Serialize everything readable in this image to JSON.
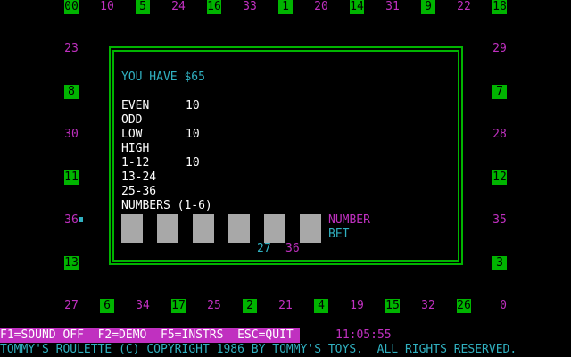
{
  "colors": {
    "background": "#000000",
    "green_cell": "#00b400",
    "magenta": "#c030c0",
    "cyan": "#30b0c0",
    "white": "#ffffff",
    "slot_gray": "#a8a8a8"
  },
  "wheel": {
    "top": [
      "00",
      "10",
      "5",
      "24",
      "16",
      "33",
      "1",
      "20",
      "14",
      "31",
      "9",
      "22",
      "18"
    ],
    "left": [
      "23",
      "8",
      "30",
      "11",
      "36",
      "13"
    ],
    "right": [
      "29",
      "7",
      "28",
      "12",
      "35",
      "3"
    ],
    "bottom": [
      "27",
      "6",
      "34",
      "17",
      "25",
      "2",
      "21",
      "4",
      "19",
      "15",
      "32",
      "26",
      "0"
    ]
  },
  "panel": {
    "balance": "YOU HAVE $65",
    "bets": [
      {
        "label": "EVEN",
        "amount": "10"
      },
      {
        "label": "ODD",
        "amount": ""
      },
      {
        "label": "LOW",
        "amount": "10"
      },
      {
        "label": "HIGH",
        "amount": ""
      },
      {
        "label": "1-12",
        "amount": "10"
      },
      {
        "label": "13-24",
        "amount": ""
      },
      {
        "label": "25-36",
        "amount": ""
      }
    ],
    "numbers_label": "NUMBERS (1-6)",
    "number_label": "NUMBER",
    "bet_label": "BET",
    "number_values": [
      "27",
      "36"
    ]
  },
  "status": {
    "function_keys": "F1=SOUND OFF  F2=DEMO  F5=INSTRS  ESC=QUIT",
    "clock": "11:05:55",
    "copyright": "TOMMY'S ROULETTE (C) COPYRIGHT 1986 BY TOMMY'S TOYS.  ALL RIGHTS RESERVED."
  }
}
